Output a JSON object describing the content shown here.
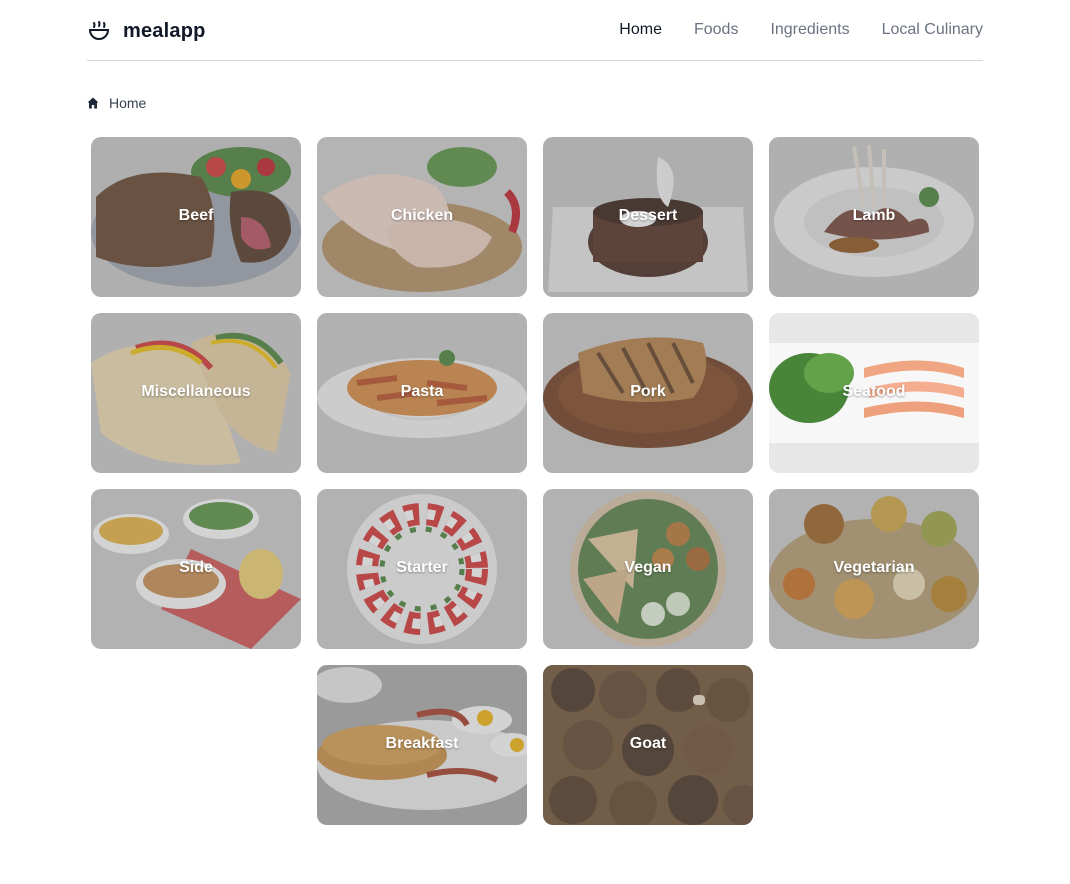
{
  "app": {
    "name": "mealapp"
  },
  "nav": {
    "items": [
      "Home",
      "Foods",
      "Ingredients",
      "Local Culinary"
    ],
    "active": "Home"
  },
  "breadcrumb": {
    "label": "Home"
  },
  "categories": [
    "Beef",
    "Chicken",
    "Dessert",
    "Lamb",
    "Miscellaneous",
    "Pasta",
    "Pork",
    "Seafood",
    "Side",
    "Starter",
    "Vegan",
    "Vegetarian",
    "Breakfast",
    "Goat"
  ],
  "colors": {
    "accent": "#111827",
    "muted": "#6b7280",
    "divider": "#d4d4d8",
    "card_bg": "#b5b5b5"
  }
}
